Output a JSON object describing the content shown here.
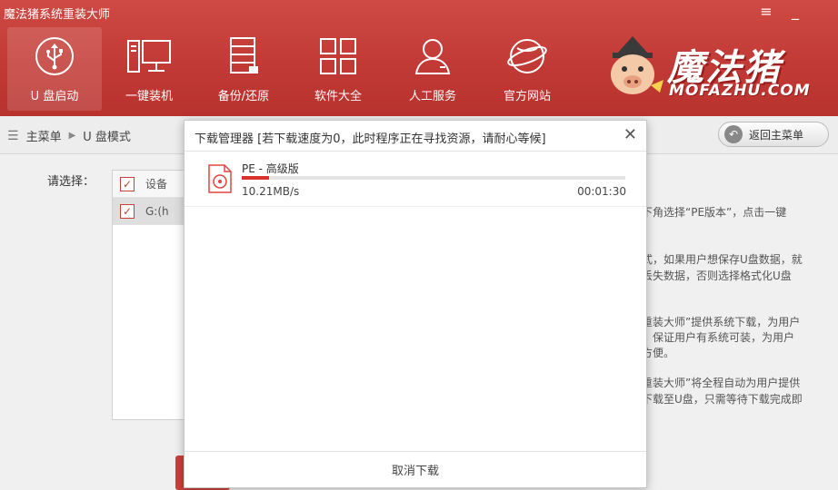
{
  "window": {
    "title": "魔法猪系统重装大师",
    "menu_icon": "hamburger-icon",
    "minimize_icon": "minimize-icon"
  },
  "nav": [
    {
      "label": "U 盘启动",
      "icon": "usb-icon",
      "active": true
    },
    {
      "label": "一键装机",
      "icon": "computer-icon",
      "active": false
    },
    {
      "label": "备份/还原",
      "icon": "backup-icon",
      "active": false
    },
    {
      "label": "软件大全",
      "icon": "apps-grid-icon",
      "active": false
    },
    {
      "label": "人工服务",
      "icon": "person-icon",
      "active": false
    },
    {
      "label": "官方网站",
      "icon": "globe-icon",
      "active": false
    }
  ],
  "logo": {
    "text": "魔法猪",
    "subtext": "MOFAZHU.COM"
  },
  "breadcrumb": {
    "items": [
      "主菜单",
      "U 盘模式"
    ],
    "back_button": "返回主菜单"
  },
  "content": {
    "choose_label": "请选择：",
    "table_header": "设备",
    "table_row": "G:(h",
    "side_lines": [
      "下角选择“PE版本”，点击一键",
      "式，如果用户想保存U盘数据，就",
      "丢失数据，否则选择格式化U盘",
      "重装大师”提供系统下载，为用户",
      "，保证用户有系统可装，为用户",
      "方便。",
      "重装大师”将全程自动为用户提供",
      "下载至U盘，只需等待下载完成即",
      "。"
    ]
  },
  "modal": {
    "title": "下载管理器 [若下载速度为0，此时程序正在寻找资源，请耐心等候]",
    "close_icon": "close-icon",
    "download": {
      "name": "PE - 高级版",
      "icon": "disc-file-icon",
      "progress_percent": 7,
      "speed": "10.21MB/s",
      "time": "00:01:30"
    },
    "cancel_label": "取消下载"
  },
  "colors": {
    "brand_red": "#c23a35",
    "progress_red": "#d9322a"
  }
}
